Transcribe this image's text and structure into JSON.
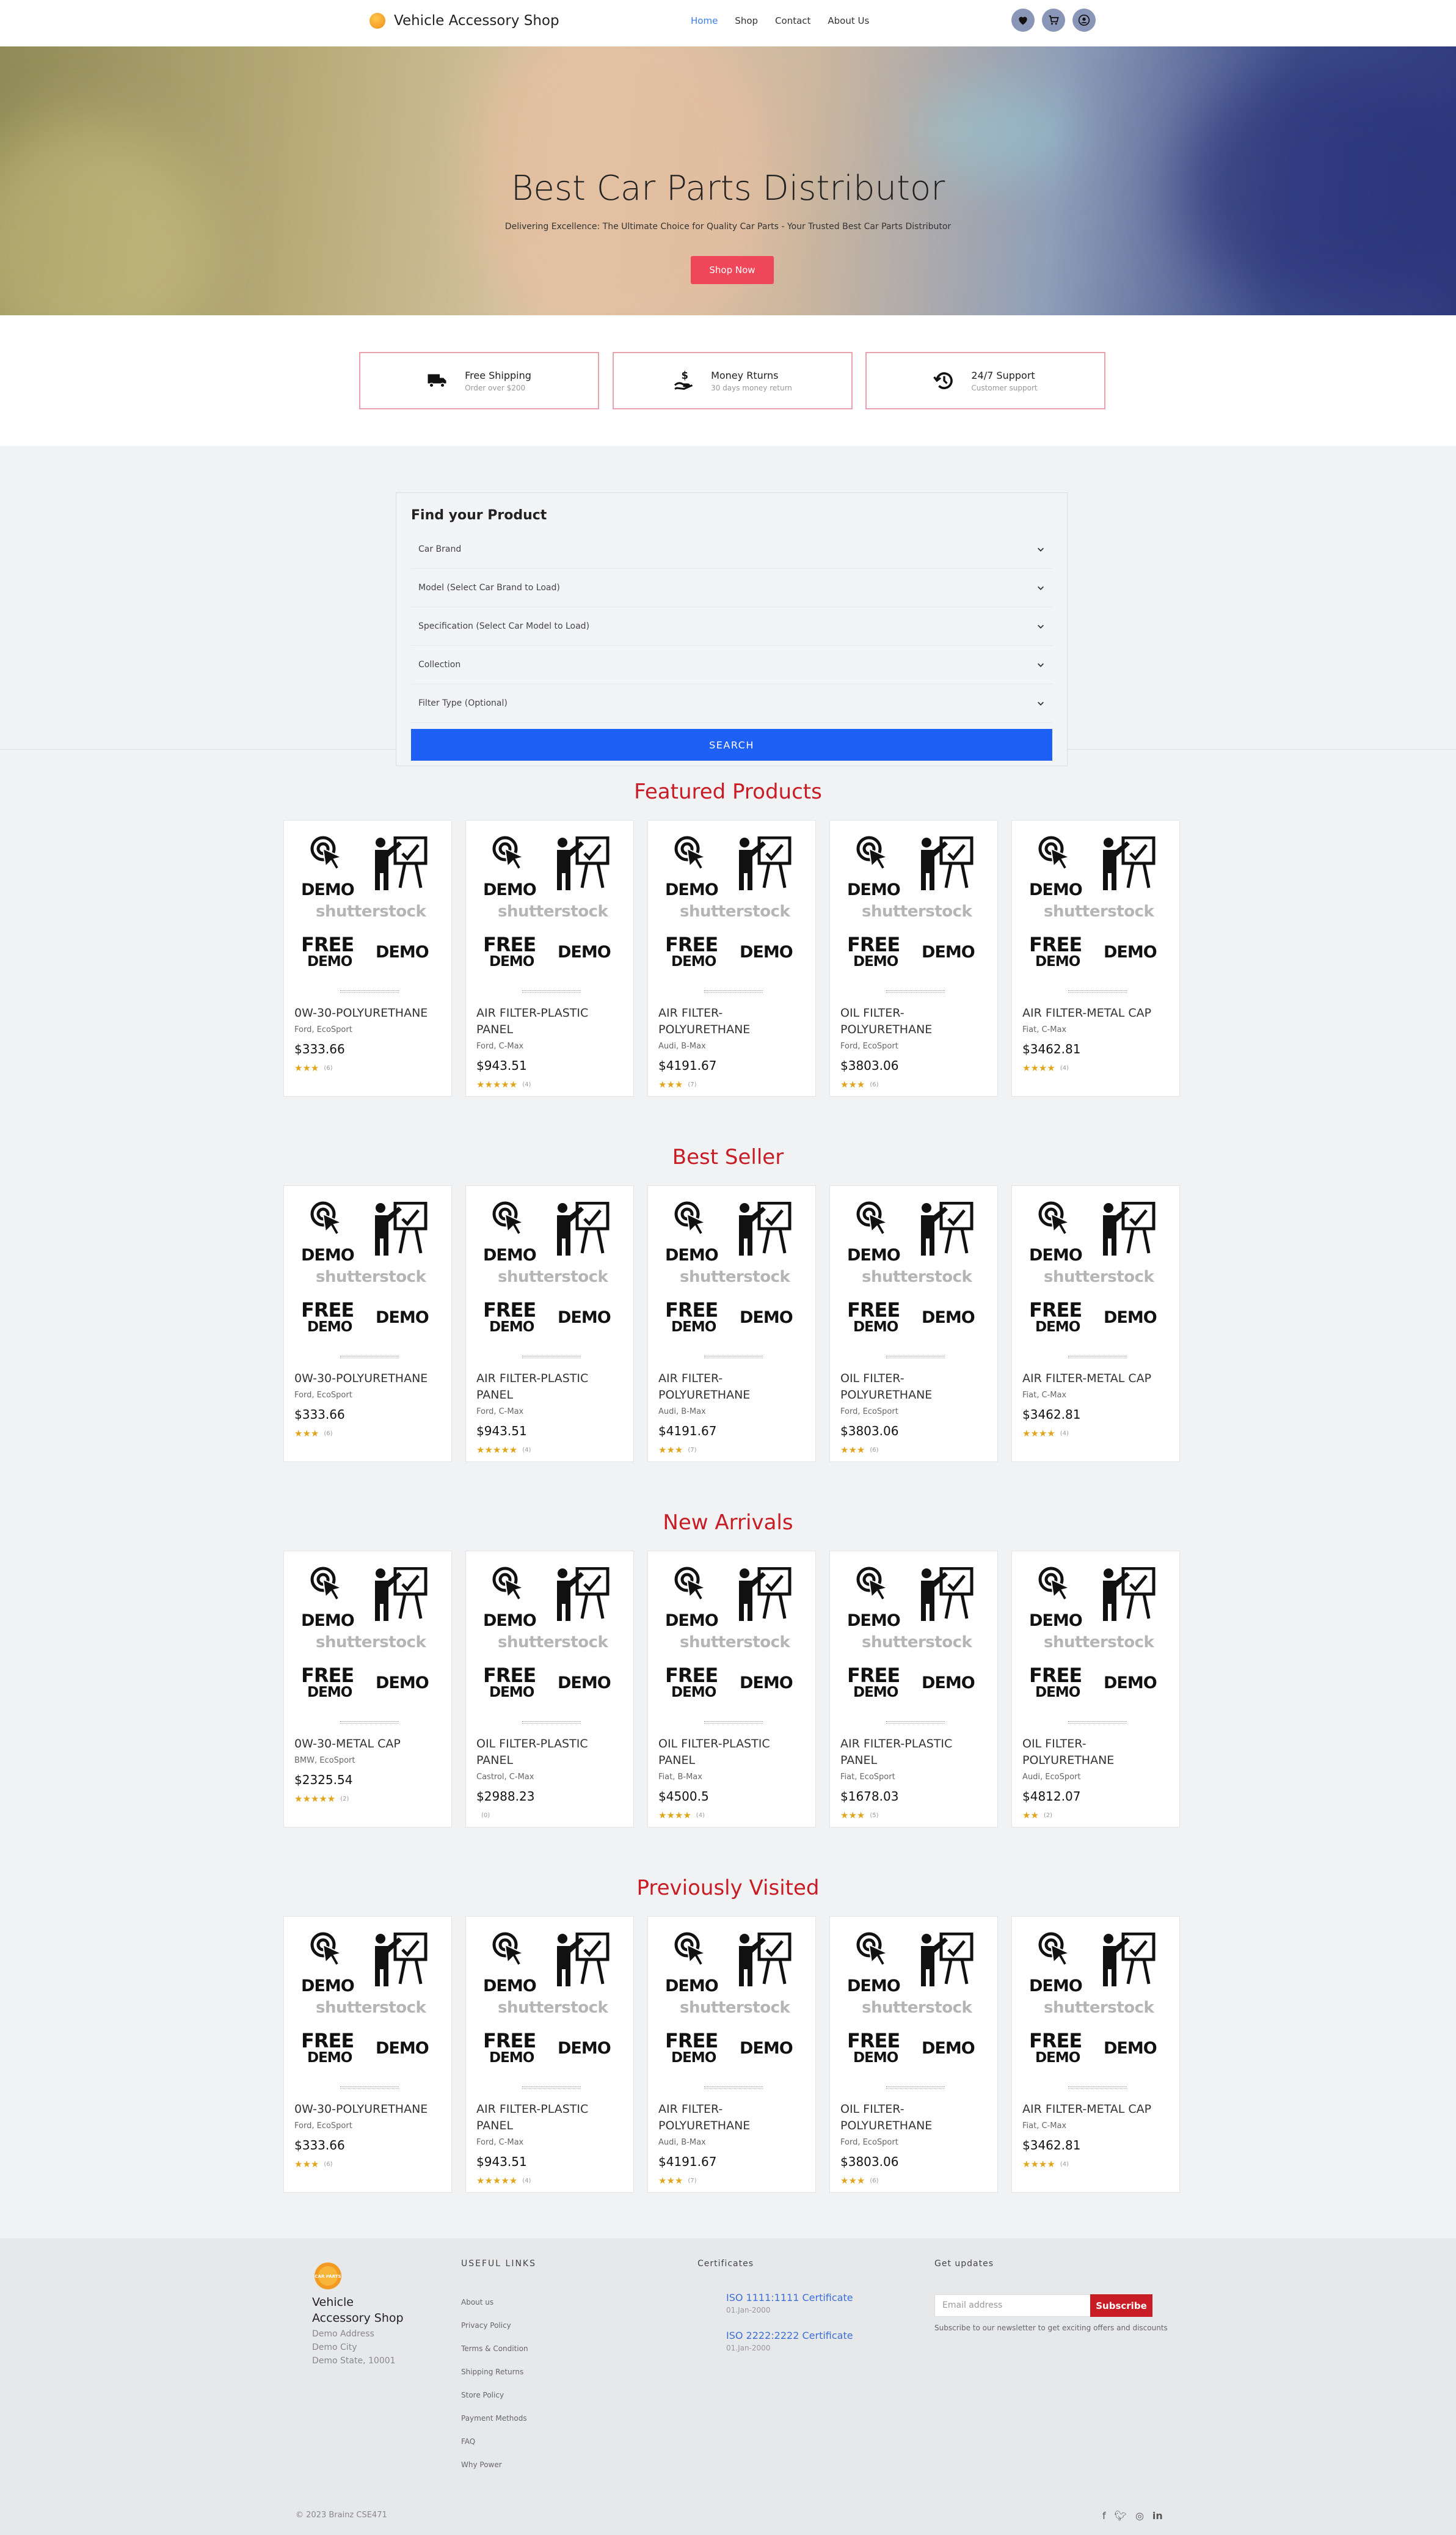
{
  "header": {
    "brand": "Vehicle Accessory Shop",
    "menu": [
      "Home",
      "Shop",
      "Contact",
      "About Us"
    ],
    "active_menu": "Home",
    "icons": [
      "heart-icon",
      "cart-icon",
      "user-icon"
    ]
  },
  "hero": {
    "title": "Best Car Parts Distributor",
    "subtitle": "Delivering Excellence: The Ultimate Choice for Quality Car Parts - Your Trusted Best Car Parts Distributor",
    "button": "Shop Now",
    "button_color": "#f0465a"
  },
  "features": [
    {
      "title": "Free Shipping",
      "sub": "Order over $200",
      "icon": "truck-icon"
    },
    {
      "title": "Money Rturns",
      "sub": "30 days money return",
      "icon": "money-hand-icon"
    },
    {
      "title": "24/7 Support",
      "sub": "Customer support",
      "icon": "clock-history-icon"
    }
  ],
  "finder": {
    "title": "Find your Product",
    "selects": [
      "Car Brand",
      "Model (Select Car Brand to Load)",
      "Specification (Select Car Model to Load)",
      "Collection",
      "Filter Type (Optional)"
    ],
    "button": "SEARCH",
    "button_color": "#1e5ff5"
  },
  "demo_image": {
    "lines": [
      "DEMO",
      "shutterstock",
      "FREE",
      "DEMO",
      "DEMO"
    ]
  },
  "sections": [
    {
      "title": "Featured Products",
      "products": [
        {
          "name": "0W-30-POLYURETHANE",
          "meta": "Ford, EcoSport",
          "price": "$333.66",
          "rating": 3,
          "count": "(6)"
        },
        {
          "name": "AIR FILTER-PLASTIC PANEL",
          "meta": "Ford, C-Max",
          "price": "$943.51",
          "rating": 5,
          "count": "(4)"
        },
        {
          "name": "AIR FILTER-POLYURETHANE",
          "meta": "Audi, B-Max",
          "price": "$4191.67",
          "rating": 3,
          "count": "(7)"
        },
        {
          "name": "OIL FILTER-POLYURETHANE",
          "meta": "Ford, EcoSport",
          "price": "$3803.06",
          "rating": 3,
          "count": "(6)"
        },
        {
          "name": "AIR FILTER-METAL CAP",
          "meta": "Fiat, C-Max",
          "price": "$3462.81",
          "rating": 4,
          "count": "(4)"
        }
      ]
    },
    {
      "title": "Best Seller",
      "products": [
        {
          "name": "0W-30-POLYURETHANE",
          "meta": "Ford, EcoSport",
          "price": "$333.66",
          "rating": 3,
          "count": "(6)"
        },
        {
          "name": "AIR FILTER-PLASTIC PANEL",
          "meta": "Ford, C-Max",
          "price": "$943.51",
          "rating": 5,
          "count": "(4)"
        },
        {
          "name": "AIR FILTER-POLYURETHANE",
          "meta": "Audi, B-Max",
          "price": "$4191.67",
          "rating": 3,
          "count": "(7)"
        },
        {
          "name": "OIL FILTER-POLYURETHANE",
          "meta": "Ford, EcoSport",
          "price": "$3803.06",
          "rating": 3,
          "count": "(6)"
        },
        {
          "name": "AIR FILTER-METAL CAP",
          "meta": "Fiat, C-Max",
          "price": "$3462.81",
          "rating": 4,
          "count": "(4)"
        }
      ]
    },
    {
      "title": "New Arrivals",
      "products": [
        {
          "name": "0W-30-METAL CAP",
          "meta": "BMW, EcoSport",
          "price": "$2325.54",
          "rating": 5,
          "count": "(2)"
        },
        {
          "name": "OIL FILTER-PLASTIC PANEL",
          "meta": "Castrol, C-Max",
          "price": "$2988.23",
          "rating": 0,
          "count": "(0)"
        },
        {
          "name": "OIL FILTER-PLASTIC PANEL",
          "meta": "Fiat, B-Max",
          "price": "$4500.5",
          "rating": 4,
          "count": "(4)"
        },
        {
          "name": "AIR FILTER-PLASTIC PANEL",
          "meta": "Fiat, EcoSport",
          "price": "$1678.03",
          "rating": 3,
          "count": "(5)"
        },
        {
          "name": "OIL FILTER-POLYURETHANE",
          "meta": "Audi, EcoSport",
          "price": "$4812.07",
          "rating": 2,
          "count": "(2)"
        }
      ]
    },
    {
      "title": "Previously Visited",
      "products": [
        {
          "name": "0W-30-POLYURETHANE",
          "meta": "Ford, EcoSport",
          "price": "$333.66",
          "rating": 3,
          "count": "(6)"
        },
        {
          "name": "AIR FILTER-PLASTIC PANEL",
          "meta": "Ford, C-Max",
          "price": "$943.51",
          "rating": 5,
          "count": "(4)"
        },
        {
          "name": "AIR FILTER-POLYURETHANE",
          "meta": "Audi, B-Max",
          "price": "$4191.67",
          "rating": 3,
          "count": "(7)"
        },
        {
          "name": "OIL FILTER-POLYURETHANE",
          "meta": "Ford, EcoSport",
          "price": "$3803.06",
          "rating": 3,
          "count": "(6)"
        },
        {
          "name": "AIR FILTER-METAL CAP",
          "meta": "Fiat, C-Max",
          "price": "$3462.81",
          "rating": 4,
          "count": "(4)"
        }
      ]
    }
  ],
  "footer": {
    "brand": "Vehicle Accessory Shop",
    "address": [
      "Demo Address",
      "Demo City",
      "Demo State, 10001"
    ],
    "useful_links_title": "USEFUL LINKS",
    "useful_links": [
      "About us",
      "Privacy Policy",
      "Terms & Condition",
      "Shipping Returns",
      "Store Policy",
      "Payment Methods",
      "FAQ",
      "Why Power"
    ],
    "certificates_title": "Certificates",
    "certificates": [
      {
        "name": "ISO 1111:1111 Certificate",
        "date": "01.Jan-2000"
      },
      {
        "name": "ISO 2222:2222 Certificate",
        "date": "01.Jan-2000"
      }
    ],
    "updates_title": "Get updates",
    "email_placeholder": "Email address",
    "subscribe": "Subscribe",
    "subscribe_note": "Subscribe to our newsletter to get exciting offers and discounts",
    "copyright": "© 2023 Brainz CSE471",
    "social": [
      "facebook-icon",
      "twitter-icon",
      "instagram-icon",
      "linkedin-icon"
    ]
  },
  "colors": {
    "accent_red": "#c81d25",
    "link_blue": "#3a7df0"
  }
}
